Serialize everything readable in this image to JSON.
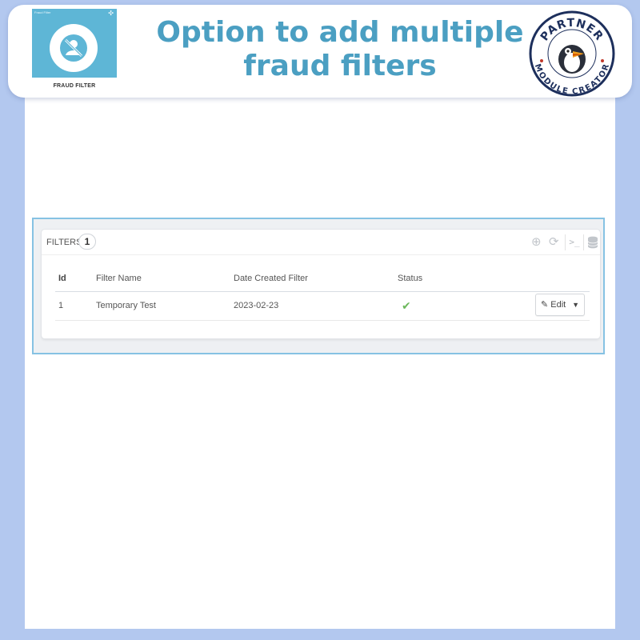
{
  "banner": {
    "module_logo_label": "FRAUD FILTER",
    "module_logo_small_text": "Fraud Filter",
    "module_logo_icon": "no-user-icon",
    "headline_line1": "Option to add multiple",
    "headline_line2": "fraud filters",
    "badge_top": "PARTNER",
    "badge_bottom": "MODULE CREATOR"
  },
  "panel": {
    "title": "FILTERS",
    "count": "1",
    "toolbar_icons": [
      "add-icon",
      "refresh-icon",
      "sql-query-icon",
      "database-icon"
    ],
    "sql_label": ">_"
  },
  "table": {
    "columns": [
      "Id",
      "Filter Name",
      "Date Created Filter",
      "Status"
    ],
    "rows": [
      {
        "id": "1",
        "name": "Temporary Test",
        "date": "2023-02-23",
        "status": "✔",
        "action": "Edit"
      }
    ]
  },
  "colors": {
    "background": "#b3c8ef",
    "headline": "#4b9fc2",
    "logo_bg": "#5eb6d6",
    "panel_border": "#86c2e3",
    "status_ok": "#6cb85c",
    "badge_navy": "#1d2f5c"
  }
}
